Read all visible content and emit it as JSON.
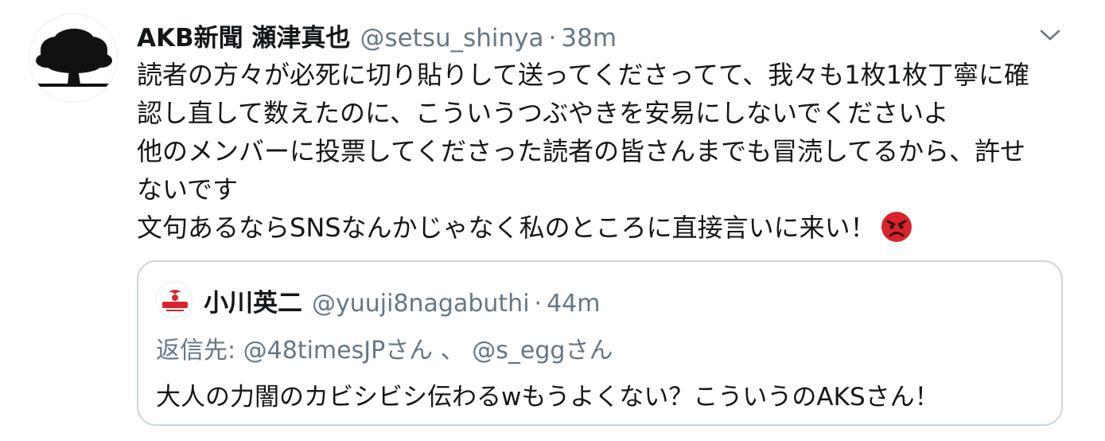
{
  "tweet": {
    "display_name": "AKB新聞 瀬津真也",
    "handle": "@setsu_shinya",
    "separator": "·",
    "time": "38m",
    "body_lines": [
      "読者の方々が必死に切り貼りして送ってくださってて、我々も1枚1枚丁寧に確",
      "認し直して数えたのに、こういうつぶやきを安易にしないでくださいよ",
      "他のメンバーに投票してくださった読者の皆さんまでも冒涜してるから、許せ",
      "ないです",
      "文句あるならSNSなんかじゃなく私のところに直接言いに来い！"
    ],
    "emoji": "angry-face",
    "menu_icon": "chevron-down-icon"
  },
  "quoted_tweet": {
    "display_name": "小川英二",
    "handle": "@yuuji8nagabuthi",
    "separator": "·",
    "time": "44m",
    "reply_prefix": "返信先: ",
    "reply_to_1": "@48timesJPさん",
    "reply_joiner": " 、 ",
    "reply_to_2": "@s_eggさん",
    "text": "大人の力闇のカビシビシ伝わるwもうよくない？こういうのAKSさん！"
  },
  "colors": {
    "text_primary": "#14171a",
    "text_secondary": "#657786",
    "border": "#ccd6dd",
    "emoji_red": "#d8242b"
  }
}
